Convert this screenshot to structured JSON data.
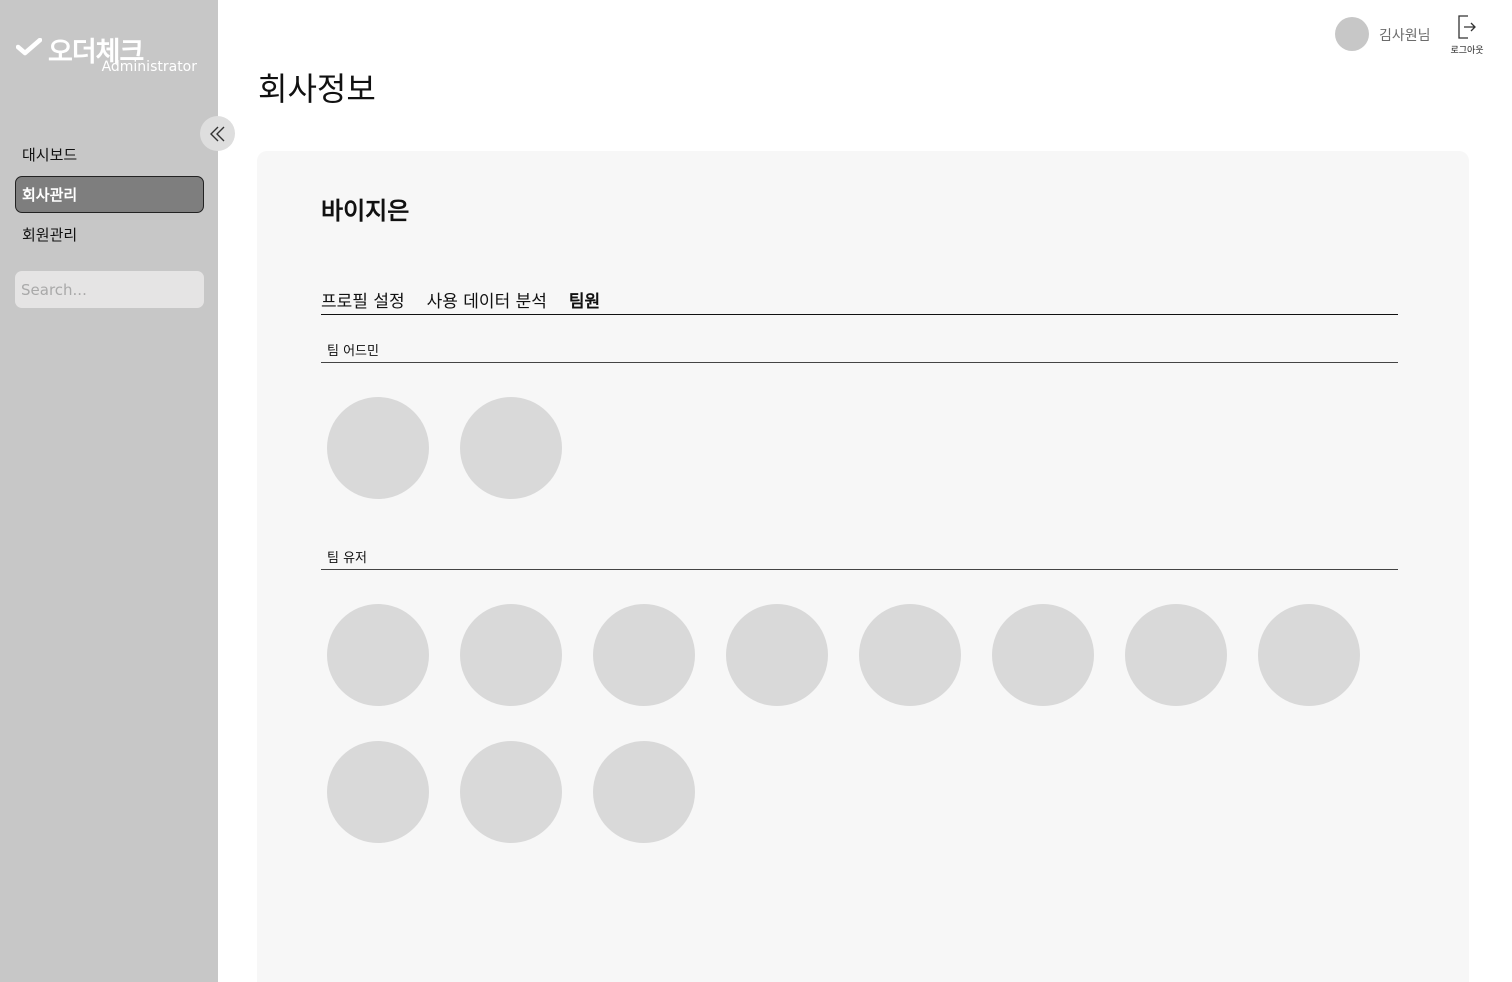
{
  "sidebar": {
    "logo_text": "오더체크",
    "logo_sub": "Administrator",
    "collapse_icon": "double-chevron-left-icon",
    "items": [
      {
        "label": "대시보드",
        "active": false
      },
      {
        "label": "회사관리",
        "active": true
      },
      {
        "label": "회원관리",
        "active": false
      }
    ],
    "search_placeholder": "Search..."
  },
  "header": {
    "user_name": "김사원님",
    "logout_label": "로그아웃",
    "logout_icon": "logout-icon"
  },
  "page": {
    "title": "회사정보",
    "company_name": "바이지은",
    "tabs": [
      {
        "label": "프로필 설정",
        "active": false
      },
      {
        "label": "사용 데이터 분석",
        "active": false
      },
      {
        "label": "팀원",
        "active": true
      }
    ],
    "sections": {
      "admins": {
        "title": "팀 어드민",
        "count": 2
      },
      "users": {
        "title": "팀 유저",
        "count": 11
      }
    }
  },
  "colors": {
    "sidebar_bg": "#c7c7c7",
    "active_nav_bg": "#7e7e7e",
    "panel_bg": "#f7f7f7",
    "avatar_placeholder": "#d9d9d9"
  }
}
